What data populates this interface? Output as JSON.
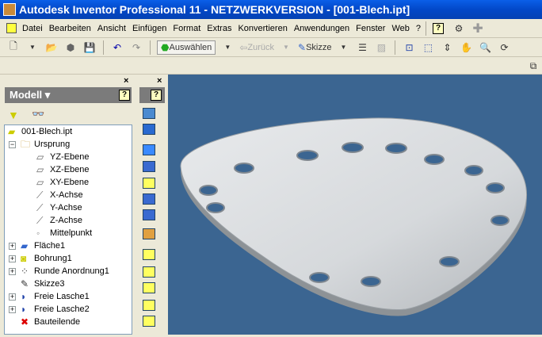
{
  "window": {
    "title": "Autodesk Inventor Professional 11 - NETZWERKVERSION - [001-Blech.ipt]"
  },
  "menu": [
    "Datei",
    "Bearbeiten",
    "Ansicht",
    "Einfügen",
    "Format",
    "Extras",
    "Konvertieren",
    "Anwendungen",
    "Fenster",
    "Web",
    "?"
  ],
  "toolbar": {
    "select_label": "Auswählen",
    "back_label": "Zurück",
    "sketch_label": "Skizze"
  },
  "browser": {
    "title": "Modell",
    "help": "?",
    "close": "×"
  },
  "tools": {
    "help": "?",
    "close": "×"
  },
  "tree": [
    {
      "label": "001-Blech.ipt",
      "icon": "part-icon"
    },
    {
      "label": "Ursprung",
      "icon": "folder-icon",
      "expanded": true
    },
    {
      "label": "YZ-Ebene",
      "icon": "plane-icon"
    },
    {
      "label": "XZ-Ebene",
      "icon": "plane-icon"
    },
    {
      "label": "XY-Ebene",
      "icon": "plane-icon"
    },
    {
      "label": "X-Achse",
      "icon": "axis-icon"
    },
    {
      "label": "Y-Achse",
      "icon": "axis-icon"
    },
    {
      "label": "Z-Achse",
      "icon": "axis-icon"
    },
    {
      "label": "Mittelpunkt",
      "icon": "point-icon"
    },
    {
      "label": "Fläche1",
      "icon": "face-icon"
    },
    {
      "label": "Bohrung1",
      "icon": "hole-icon"
    },
    {
      "label": "Runde Anordnung1",
      "icon": "pattern-icon"
    },
    {
      "label": "Skizze3",
      "icon": "sketch-icon"
    },
    {
      "label": "Freie Lasche1",
      "icon": "flange-icon"
    },
    {
      "label": "Freie Lasche2",
      "icon": "flange-icon"
    },
    {
      "label": "Bauteilende",
      "icon": "end-of-part-icon"
    }
  ],
  "colors": {
    "viewport": "#3b6591",
    "titlebar": "#0248c8"
  }
}
